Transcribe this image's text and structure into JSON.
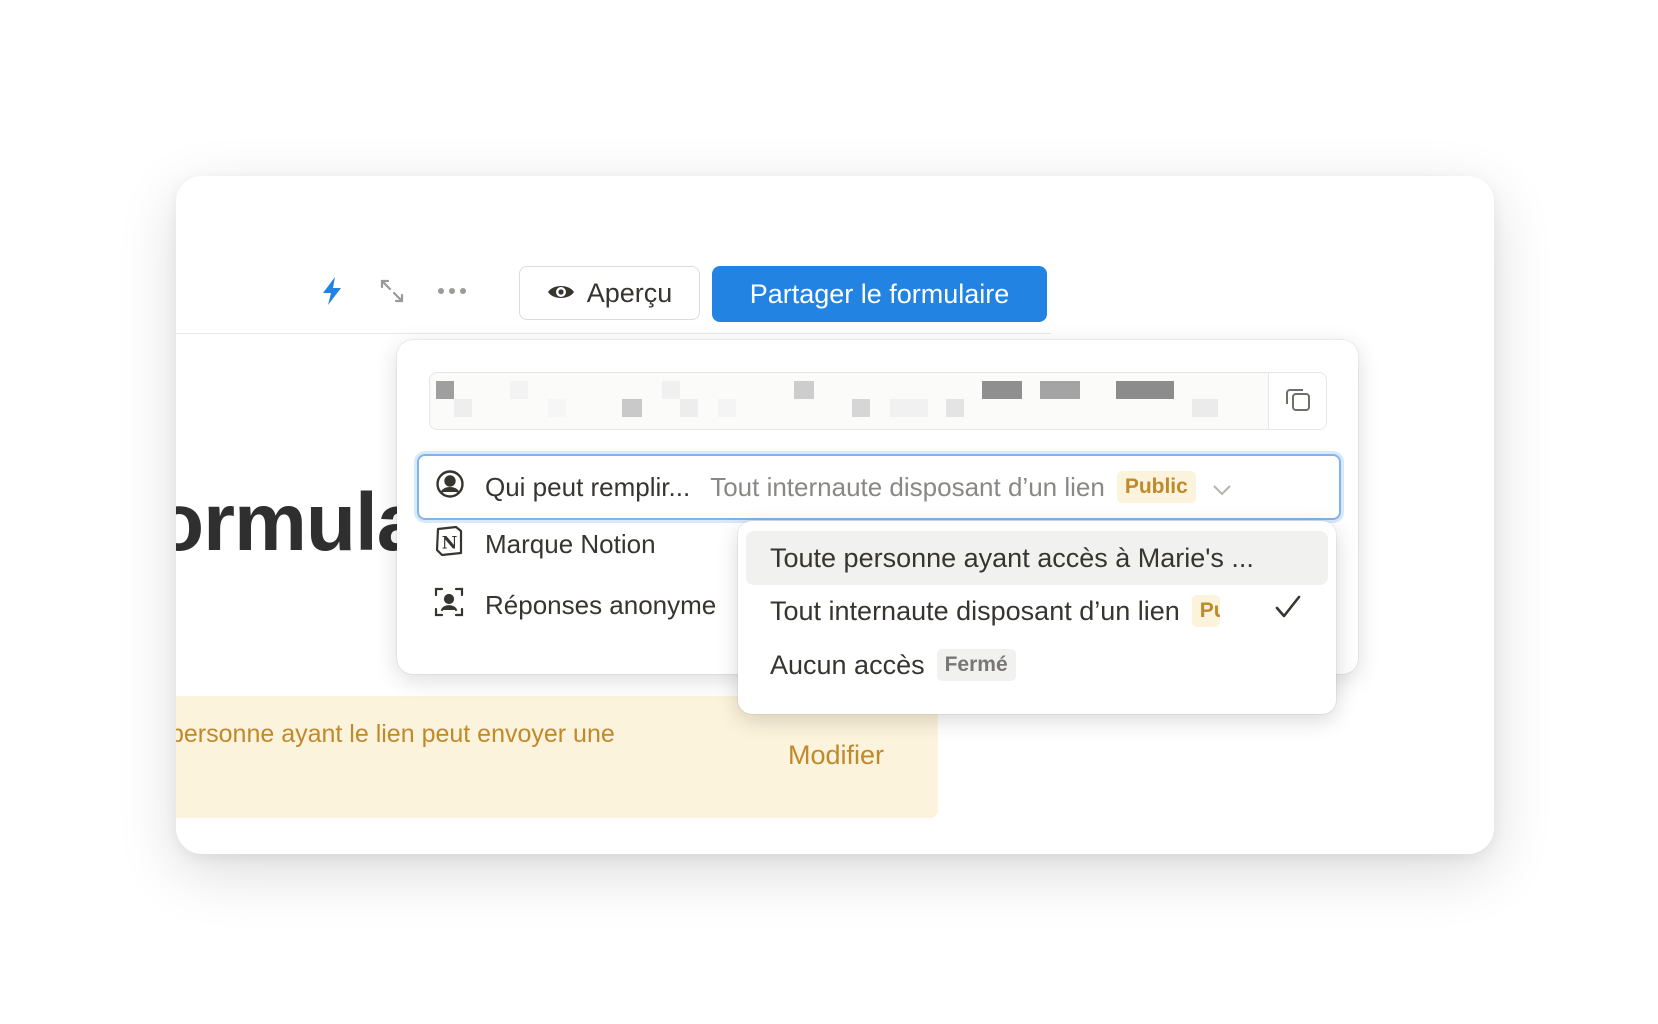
{
  "toolbar": {
    "bolt_icon": "bolt-icon",
    "expand_icon": "expand-icon",
    "more_icon": "more-icon",
    "preview_label": "Aperçu",
    "share_label": "Partager le formulaire"
  },
  "page": {
    "title_fragment": "ormula",
    "banner_text": "personne ayant le lien peut envoyer une",
    "banner_action": "Modifier"
  },
  "share_popup": {
    "who": {
      "label": "Qui peut remplir...",
      "value": "Tout internaute disposant d’un lien",
      "badge": "Public"
    },
    "options": [
      {
        "icon": "notion-logo-icon",
        "label": "Marque Notion"
      },
      {
        "icon": "anonymous-user-icon",
        "label": "Réponses anonyme"
      }
    ]
  },
  "dropdown": {
    "items": [
      {
        "label": "Toute personne ayant accès à Marie's ...",
        "badge": "",
        "selected": false
      },
      {
        "label": "Tout internaute disposant d’un lien",
        "badge": "Pu",
        "selected": true
      },
      {
        "label": "Aucun accès",
        "badge": "Fermé",
        "selected": false
      }
    ]
  },
  "colors": {
    "accent": "#2383e2",
    "public_badge_bg": "#fbf3db",
    "public_badge_text": "#c0892b",
    "closed_badge_bg": "#f1f1ef",
    "closed_badge_text": "#787774"
  }
}
